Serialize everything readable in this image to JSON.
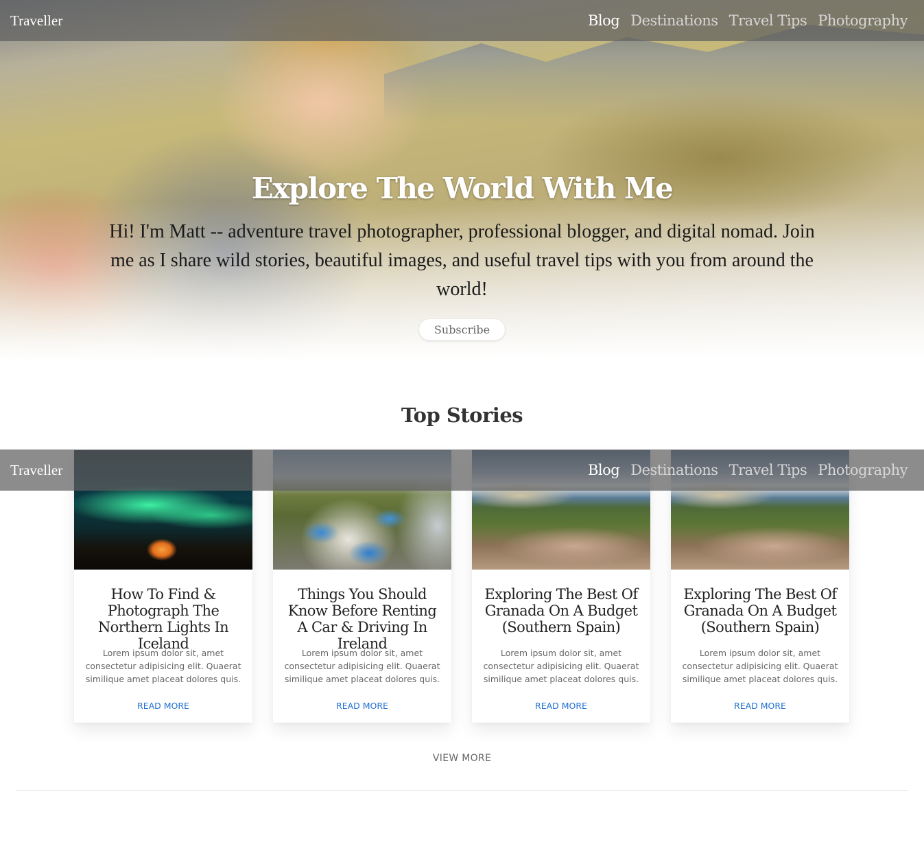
{
  "brand": "Traveller",
  "nav": [
    {
      "label": "Blog",
      "active": true
    },
    {
      "label": "Destinations",
      "active": false
    },
    {
      "label": "Travel Tips",
      "active": false
    },
    {
      "label": "Photography",
      "active": false
    }
  ],
  "hero": {
    "title": "Explore The World With Me",
    "text": "Hi! I'm Matt -- adventure travel photographer, professional blogger, and digital nomad. Join me as I share wild stories, beautiful images, and useful travel tips with you from around the world!",
    "button": "Subscribe"
  },
  "top_stories": {
    "title": "Top Stories",
    "cards": [
      {
        "title": "How To Find & Photograph The Northern Lights In Iceland",
        "text": "Lorem ipsum dolor sit, amet consectetur adipisicing elit. Quaerat similique amet placeat dolores quis.",
        "link": "READ MORE",
        "image": "northern-lights-tent"
      },
      {
        "title": "Things You Should Know Before Renting A Car & Driving In Ireland",
        "text": "Lorem ipsum dolor sit, amet consectetur adipisicing elit. Quaerat similique amet placeat dolores quis.",
        "link": "READ MORE",
        "image": "sheep-on-road"
      },
      {
        "title": "Exploring The Best Of Granada On A Budget (Southern Spain)",
        "text": "Lorem ipsum dolor sit, amet consectetur adipisicing elit. Quaerat similique amet placeat dolores quis.",
        "link": "READ MORE",
        "image": "granada-alhambra"
      },
      {
        "title": "Exploring The Best Of Granada On A Budget (Southern Spain)",
        "text": "Lorem ipsum dolor sit, amet consectetur adipisicing elit. Quaerat similique amet placeat dolores quis.",
        "link": "READ MORE",
        "image": "granada-alhambra"
      }
    ],
    "view_more": "VIEW MORE"
  }
}
